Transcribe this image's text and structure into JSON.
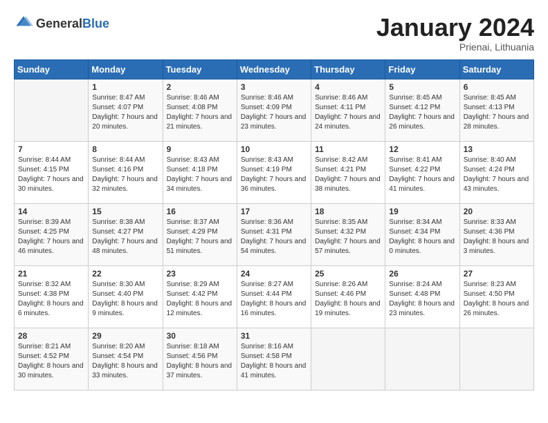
{
  "header": {
    "logo_general": "General",
    "logo_blue": "Blue",
    "month_year": "January 2024",
    "location": "Prienai, Lithuania"
  },
  "weekdays": [
    "Sunday",
    "Monday",
    "Tuesday",
    "Wednesday",
    "Thursday",
    "Friday",
    "Saturday"
  ],
  "weeks": [
    [
      {
        "day": "",
        "sunrise": "",
        "sunset": "",
        "daylight": ""
      },
      {
        "day": "1",
        "sunrise": "Sunrise: 8:47 AM",
        "sunset": "Sunset: 4:07 PM",
        "daylight": "Daylight: 7 hours and 20 minutes."
      },
      {
        "day": "2",
        "sunrise": "Sunrise: 8:46 AM",
        "sunset": "Sunset: 4:08 PM",
        "daylight": "Daylight: 7 hours and 21 minutes."
      },
      {
        "day": "3",
        "sunrise": "Sunrise: 8:46 AM",
        "sunset": "Sunset: 4:09 PM",
        "daylight": "Daylight: 7 hours and 23 minutes."
      },
      {
        "day": "4",
        "sunrise": "Sunrise: 8:46 AM",
        "sunset": "Sunset: 4:11 PM",
        "daylight": "Daylight: 7 hours and 24 minutes."
      },
      {
        "day": "5",
        "sunrise": "Sunrise: 8:45 AM",
        "sunset": "Sunset: 4:12 PM",
        "daylight": "Daylight: 7 hours and 26 minutes."
      },
      {
        "day": "6",
        "sunrise": "Sunrise: 8:45 AM",
        "sunset": "Sunset: 4:13 PM",
        "daylight": "Daylight: 7 hours and 28 minutes."
      }
    ],
    [
      {
        "day": "7",
        "sunrise": "Sunrise: 8:44 AM",
        "sunset": "Sunset: 4:15 PM",
        "daylight": "Daylight: 7 hours and 30 minutes."
      },
      {
        "day": "8",
        "sunrise": "Sunrise: 8:44 AM",
        "sunset": "Sunset: 4:16 PM",
        "daylight": "Daylight: 7 hours and 32 minutes."
      },
      {
        "day": "9",
        "sunrise": "Sunrise: 8:43 AM",
        "sunset": "Sunset: 4:18 PM",
        "daylight": "Daylight: 7 hours and 34 minutes."
      },
      {
        "day": "10",
        "sunrise": "Sunrise: 8:43 AM",
        "sunset": "Sunset: 4:19 PM",
        "daylight": "Daylight: 7 hours and 36 minutes."
      },
      {
        "day": "11",
        "sunrise": "Sunrise: 8:42 AM",
        "sunset": "Sunset: 4:21 PM",
        "daylight": "Daylight: 7 hours and 38 minutes."
      },
      {
        "day": "12",
        "sunrise": "Sunrise: 8:41 AM",
        "sunset": "Sunset: 4:22 PM",
        "daylight": "Daylight: 7 hours and 41 minutes."
      },
      {
        "day": "13",
        "sunrise": "Sunrise: 8:40 AM",
        "sunset": "Sunset: 4:24 PM",
        "daylight": "Daylight: 7 hours and 43 minutes."
      }
    ],
    [
      {
        "day": "14",
        "sunrise": "Sunrise: 8:39 AM",
        "sunset": "Sunset: 4:25 PM",
        "daylight": "Daylight: 7 hours and 46 minutes."
      },
      {
        "day": "15",
        "sunrise": "Sunrise: 8:38 AM",
        "sunset": "Sunset: 4:27 PM",
        "daylight": "Daylight: 7 hours and 48 minutes."
      },
      {
        "day": "16",
        "sunrise": "Sunrise: 8:37 AM",
        "sunset": "Sunset: 4:29 PM",
        "daylight": "Daylight: 7 hours and 51 minutes."
      },
      {
        "day": "17",
        "sunrise": "Sunrise: 8:36 AM",
        "sunset": "Sunset: 4:31 PM",
        "daylight": "Daylight: 7 hours and 54 minutes."
      },
      {
        "day": "18",
        "sunrise": "Sunrise: 8:35 AM",
        "sunset": "Sunset: 4:32 PM",
        "daylight": "Daylight: 7 hours and 57 minutes."
      },
      {
        "day": "19",
        "sunrise": "Sunrise: 8:34 AM",
        "sunset": "Sunset: 4:34 PM",
        "daylight": "Daylight: 8 hours and 0 minutes."
      },
      {
        "day": "20",
        "sunrise": "Sunrise: 8:33 AM",
        "sunset": "Sunset: 4:36 PM",
        "daylight": "Daylight: 8 hours and 3 minutes."
      }
    ],
    [
      {
        "day": "21",
        "sunrise": "Sunrise: 8:32 AM",
        "sunset": "Sunset: 4:38 PM",
        "daylight": "Daylight: 8 hours and 6 minutes."
      },
      {
        "day": "22",
        "sunrise": "Sunrise: 8:30 AM",
        "sunset": "Sunset: 4:40 PM",
        "daylight": "Daylight: 8 hours and 9 minutes."
      },
      {
        "day": "23",
        "sunrise": "Sunrise: 8:29 AM",
        "sunset": "Sunset: 4:42 PM",
        "daylight": "Daylight: 8 hours and 12 minutes."
      },
      {
        "day": "24",
        "sunrise": "Sunrise: 8:27 AM",
        "sunset": "Sunset: 4:44 PM",
        "daylight": "Daylight: 8 hours and 16 minutes."
      },
      {
        "day": "25",
        "sunrise": "Sunrise: 8:26 AM",
        "sunset": "Sunset: 4:46 PM",
        "daylight": "Daylight: 8 hours and 19 minutes."
      },
      {
        "day": "26",
        "sunrise": "Sunrise: 8:24 AM",
        "sunset": "Sunset: 4:48 PM",
        "daylight": "Daylight: 8 hours and 23 minutes."
      },
      {
        "day": "27",
        "sunrise": "Sunrise: 8:23 AM",
        "sunset": "Sunset: 4:50 PM",
        "daylight": "Daylight: 8 hours and 26 minutes."
      }
    ],
    [
      {
        "day": "28",
        "sunrise": "Sunrise: 8:21 AM",
        "sunset": "Sunset: 4:52 PM",
        "daylight": "Daylight: 8 hours and 30 minutes."
      },
      {
        "day": "29",
        "sunrise": "Sunrise: 8:20 AM",
        "sunset": "Sunset: 4:54 PM",
        "daylight": "Daylight: 8 hours and 33 minutes."
      },
      {
        "day": "30",
        "sunrise": "Sunrise: 8:18 AM",
        "sunset": "Sunset: 4:56 PM",
        "daylight": "Daylight: 8 hours and 37 minutes."
      },
      {
        "day": "31",
        "sunrise": "Sunrise: 8:16 AM",
        "sunset": "Sunset: 4:58 PM",
        "daylight": "Daylight: 8 hours and 41 minutes."
      },
      {
        "day": "",
        "sunrise": "",
        "sunset": "",
        "daylight": ""
      },
      {
        "day": "",
        "sunrise": "",
        "sunset": "",
        "daylight": ""
      },
      {
        "day": "",
        "sunrise": "",
        "sunset": "",
        "daylight": ""
      }
    ]
  ]
}
